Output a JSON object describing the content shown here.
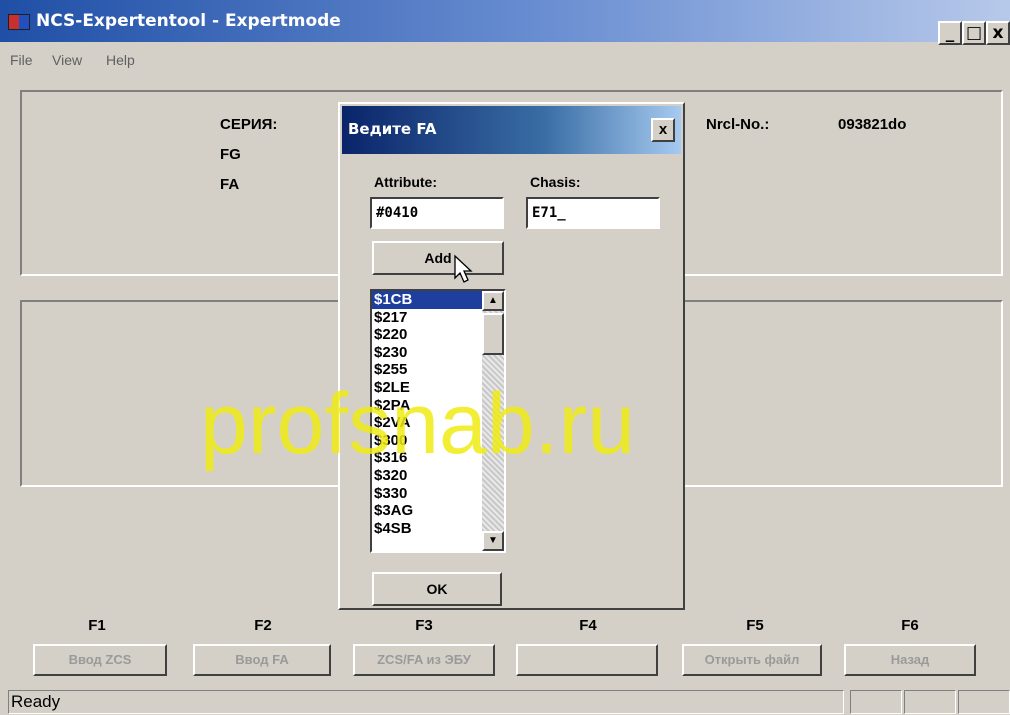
{
  "window": {
    "title": "NCS-Expertentool - Expertmode",
    "minimize": "_",
    "maximize": "□",
    "close": "x"
  },
  "menu": [
    "File",
    "View",
    "Help"
  ],
  "info": {
    "series_label": "СЕРИЯ:",
    "fg_label": "FG",
    "fa_label": "FA",
    "nrcl_label": "Nrcl-No.:",
    "nrcl_value": "093821do"
  },
  "dialog": {
    "title": "Ведите FA",
    "close": "x",
    "attribute_label": "Attribute:",
    "attribute_value": "#0410",
    "chasis_label": "Chasis:",
    "chasis_value": "E71_",
    "add_button": "Add",
    "ok_button": "OK",
    "list": [
      "$1CB",
      "$217",
      "$220",
      "$230",
      "$255",
      "$2LE",
      "$2PA",
      "$2VA",
      "$300",
      "$316",
      "$320",
      "$330",
      "$3AG",
      "$4SB"
    ],
    "selected_index": 0,
    "scroll_up": "▲",
    "scroll_down": "▼"
  },
  "function_keys": [
    {
      "key": "F1",
      "label": "Ввод ZCS"
    },
    {
      "key": "F2",
      "label": "Ввод FA"
    },
    {
      "key": "F3",
      "label": "ZCS/FA из ЭБУ"
    },
    {
      "key": "F4",
      "label": ""
    },
    {
      "key": "F5",
      "label": "Открыть файл"
    },
    {
      "key": "F6",
      "label": "Назад"
    }
  ],
  "status": {
    "text": "Ready"
  },
  "watermark": "profsnab.ru"
}
